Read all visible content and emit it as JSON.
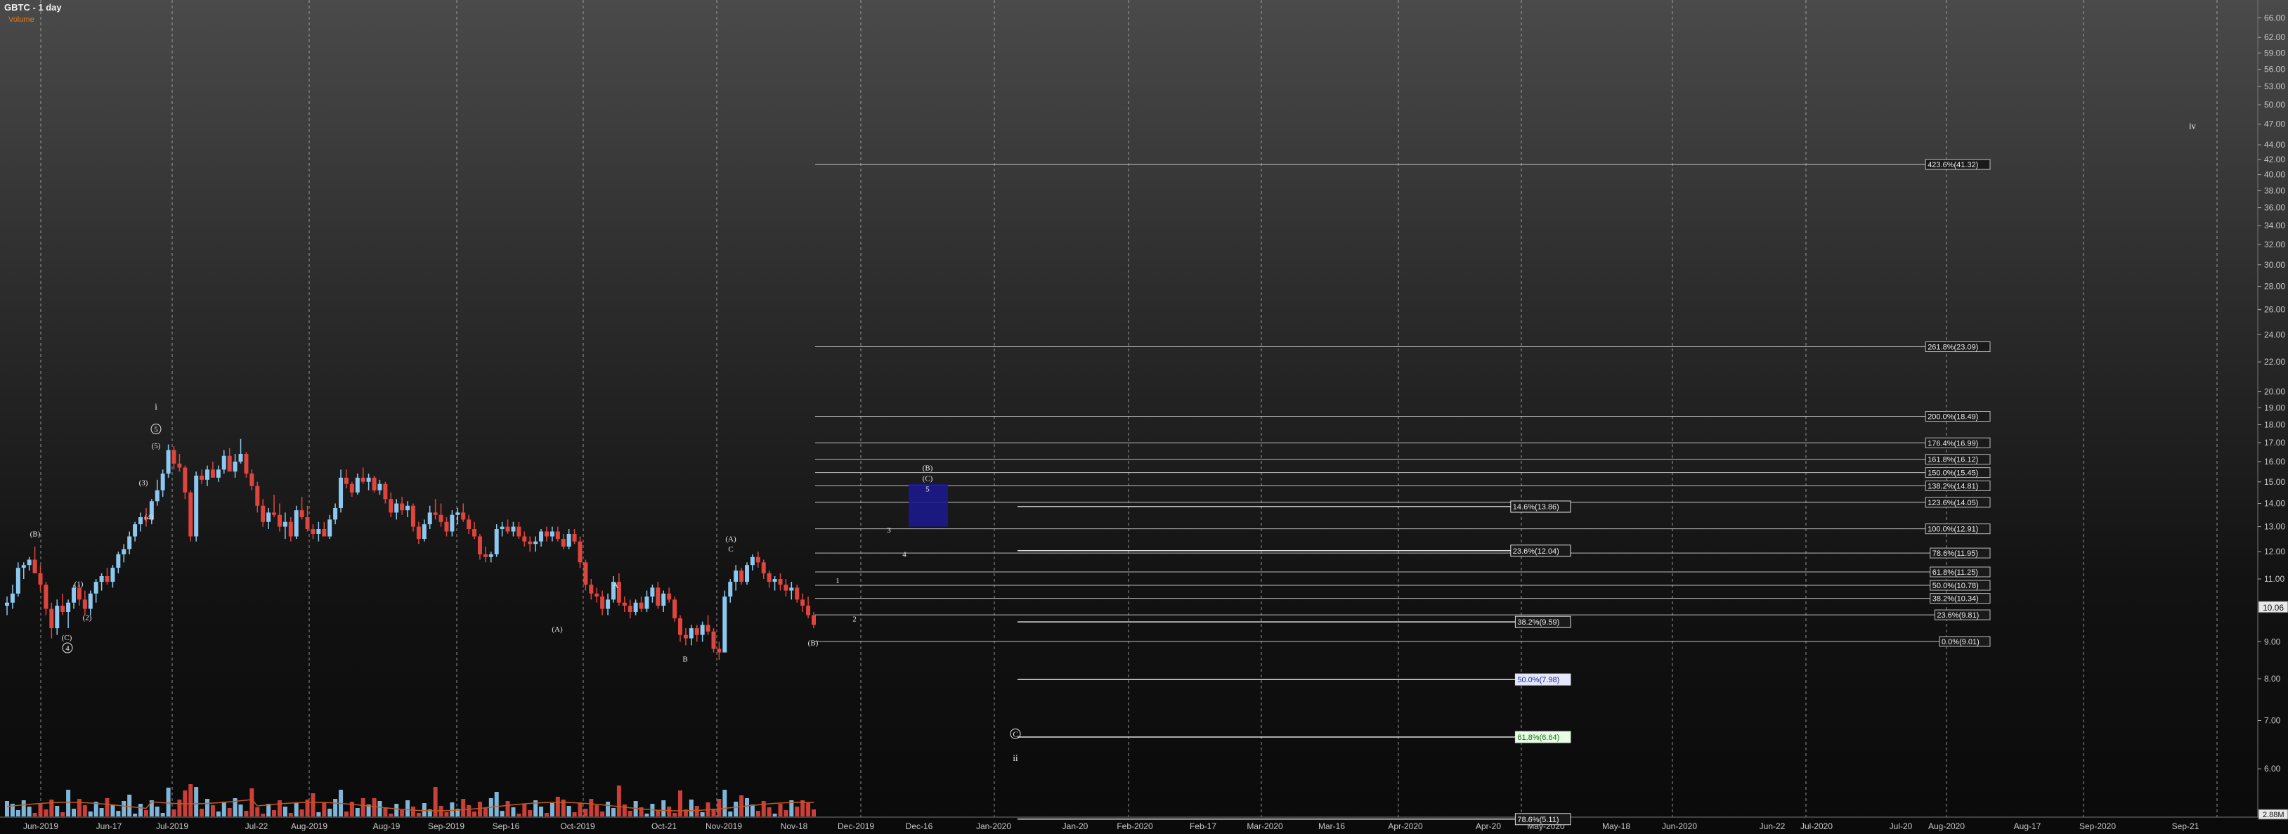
{
  "header": {
    "title": "GBTC - 1 day",
    "volume_label": "Volume"
  },
  "colors": {
    "up": "#8cc8f0",
    "down": "#e0453d",
    "grid": "#9a9a9a",
    "axis_text": "#c8c8c8",
    "box": "#1a1a8c",
    "volume_avg": "#c25a1a"
  },
  "chart_data": {
    "type": "candlestick",
    "ylim": [
      5.2,
      66.5
    ],
    "y_ticks": [
      "66.00",
      "62.00",
      "59.00",
      "56.00",
      "53.00",
      "50.00",
      "47.00",
      "44.00",
      "42.00",
      "40.00",
      "38.00",
      "36.00",
      "34.00",
      "32.00",
      "30.00",
      "28.00",
      "26.00",
      "24.00",
      "22.00",
      "20.00",
      "19.00",
      "18.00",
      "17.00",
      "16.00",
      "15.00",
      "14.00",
      "13.00",
      "12.00",
      "11.00",
      "10.00",
      "9.00",
      "8.00",
      "7.00",
      "6.00"
    ],
    "last_price": "10.06",
    "volume_readout": "2.88M",
    "x_labels": [
      "Jun-2019",
      "Jun-17",
      "Jul-2019",
      "Jul-22",
      "Aug-2019",
      "Aug-19",
      "Sep-2019",
      "Sep-16",
      "Oct-2019",
      "Oct-21",
      "Nov-2019",
      "Nov-18",
      "Dec-2019",
      "Dec-16",
      "Jan-2020",
      "Jan-20",
      "Feb-2020",
      "Feb-17",
      "Mar-2020",
      "Mar-16",
      "Apr-2020",
      "Apr-20",
      "May-2020",
      "May-18",
      "Jun-2020",
      "Jun-22",
      "Jul-2020",
      "Jul-20",
      "Aug-2020",
      "Aug-17",
      "Sep-2020",
      "Sep-21"
    ],
    "candles": [
      [
        10.1,
        10.4,
        9.8,
        10.2
      ],
      [
        10.2,
        10.8,
        10.0,
        10.5
      ],
      [
        10.5,
        11.6,
        10.4,
        11.4
      ],
      [
        11.4,
        11.6,
        11.0,
        11.5
      ],
      [
        11.5,
        11.8,
        11.3,
        11.7
      ],
      [
        11.7,
        12.2,
        11.5,
        11.2
      ],
      [
        11.2,
        11.5,
        10.6,
        10.8
      ],
      [
        10.8,
        10.9,
        9.8,
        10.0
      ],
      [
        10.0,
        10.2,
        9.1,
        9.4
      ],
      [
        9.4,
        10.3,
        9.2,
        10.1
      ],
      [
        10.1,
        10.5,
        9.8,
        9.9
      ],
      [
        9.9,
        10.3,
        9.4,
        10.2
      ],
      [
        10.2,
        10.8,
        10.0,
        10.7
      ],
      [
        10.7,
        10.8,
        10.1,
        10.3
      ],
      [
        10.3,
        10.6,
        9.8,
        10.0
      ],
      [
        10.0,
        10.6,
        9.8,
        10.5
      ],
      [
        10.5,
        11.0,
        10.2,
        10.9
      ],
      [
        10.9,
        11.2,
        10.6,
        11.1
      ],
      [
        11.1,
        11.4,
        10.8,
        10.9
      ],
      [
        10.9,
        11.5,
        10.7,
        11.4
      ],
      [
        11.4,
        12.0,
        11.2,
        11.9
      ],
      [
        11.9,
        12.3,
        11.6,
        12.1
      ],
      [
        12.1,
        12.8,
        11.9,
        12.6
      ],
      [
        12.6,
        13.2,
        12.4,
        13.1
      ],
      [
        13.1,
        13.6,
        12.8,
        13.4
      ],
      [
        13.4,
        13.8,
        13.0,
        13.3
      ],
      [
        13.3,
        14.2,
        13.1,
        14.1
      ],
      [
        14.1,
        15.1,
        13.9,
        14.6
      ],
      [
        14.6,
        15.6,
        14.3,
        15.4
      ],
      [
        15.4,
        16.9,
        15.2,
        16.6
      ],
      [
        16.6,
        16.8,
        15.6,
        15.9
      ],
      [
        15.9,
        16.4,
        15.5,
        15.7
      ],
      [
        15.7,
        15.8,
        14.2,
        14.5
      ],
      [
        14.5,
        14.6,
        12.4,
        12.6
      ],
      [
        12.6,
        15.5,
        12.4,
        15.3
      ],
      [
        15.3,
        15.6,
        14.9,
        15.1
      ],
      [
        15.1,
        15.8,
        14.8,
        15.6
      ],
      [
        15.6,
        16.0,
        15.3,
        15.2
      ],
      [
        15.2,
        15.8,
        15.0,
        15.6
      ],
      [
        15.6,
        16.6,
        15.4,
        16.3
      ],
      [
        16.3,
        16.7,
        15.9,
        15.5
      ],
      [
        15.5,
        16.4,
        15.2,
        16.0
      ],
      [
        16.0,
        17.2,
        15.9,
        16.4
      ],
      [
        16.4,
        16.5,
        15.2,
        15.4
      ],
      [
        15.4,
        15.6,
        14.6,
        14.8
      ],
      [
        14.8,
        15.0,
        13.6,
        13.9
      ],
      [
        13.9,
        14.2,
        13.0,
        13.2
      ],
      [
        13.2,
        13.8,
        12.9,
        13.6
      ],
      [
        13.6,
        14.4,
        13.4,
        13.5
      ],
      [
        13.5,
        14.0,
        12.8,
        13.0
      ],
      [
        13.0,
        13.6,
        12.5,
        13.2
      ],
      [
        13.2,
        13.4,
        12.4,
        12.6
      ],
      [
        12.6,
        13.9,
        12.5,
        13.7
      ],
      [
        13.7,
        14.3,
        13.3,
        13.4
      ],
      [
        13.4,
        13.9,
        12.8,
        12.9
      ],
      [
        12.9,
        13.1,
        12.5,
        12.7
      ],
      [
        12.7,
        13.2,
        12.4,
        12.9
      ],
      [
        12.9,
        13.2,
        12.6,
        12.6
      ],
      [
        12.6,
        13.5,
        12.5,
        13.3
      ],
      [
        13.3,
        14.0,
        13.1,
        13.8
      ],
      [
        13.8,
        15.6,
        13.6,
        15.2
      ],
      [
        15.2,
        15.6,
        14.7,
        14.9
      ],
      [
        14.9,
        15.0,
        14.3,
        14.5
      ],
      [
        14.5,
        15.4,
        14.4,
        15.2
      ],
      [
        15.2,
        15.7,
        14.9,
        15.0
      ],
      [
        15.0,
        15.4,
        14.6,
        15.2
      ],
      [
        15.2,
        15.3,
        14.5,
        14.6
      ],
      [
        14.6,
        15.1,
        14.4,
        14.9
      ],
      [
        14.9,
        15.0,
        14.0,
        14.2
      ],
      [
        14.2,
        14.5,
        13.4,
        13.6
      ],
      [
        13.6,
        14.2,
        13.3,
        14.0
      ],
      [
        14.0,
        14.3,
        13.5,
        13.7
      ],
      [
        13.7,
        14.1,
        13.4,
        13.9
      ],
      [
        13.9,
        14.0,
        12.8,
        13.0
      ],
      [
        13.0,
        13.2,
        12.3,
        12.5
      ],
      [
        12.5,
        13.3,
        12.4,
        13.1
      ],
      [
        13.1,
        13.9,
        12.9,
        13.6
      ],
      [
        13.6,
        14.2,
        13.3,
        13.5
      ],
      [
        13.5,
        14.0,
        13.0,
        13.2
      ],
      [
        13.2,
        13.4,
        12.6,
        12.8
      ],
      [
        12.8,
        13.7,
        12.6,
        13.5
      ],
      [
        13.5,
        13.8,
        13.1,
        13.6
      ],
      [
        13.6,
        14.0,
        13.2,
        13.3
      ],
      [
        13.3,
        13.5,
        12.7,
        12.9
      ],
      [
        12.9,
        13.2,
        12.5,
        12.6
      ],
      [
        12.6,
        12.7,
        11.7,
        11.9
      ],
      [
        11.9,
        12.2,
        11.6,
        11.8
      ],
      [
        11.8,
        12.0,
        11.6,
        11.9
      ],
      [
        11.9,
        13.1,
        11.8,
        12.9
      ],
      [
        12.9,
        13.2,
        12.6,
        13.0
      ],
      [
        13.0,
        13.3,
        12.7,
        12.8
      ],
      [
        12.8,
        13.2,
        12.6,
        13.0
      ],
      [
        13.0,
        13.2,
        12.5,
        12.6
      ],
      [
        12.6,
        12.8,
        12.2,
        12.4
      ],
      [
        12.4,
        12.6,
        12.0,
        12.3
      ],
      [
        12.3,
        12.6,
        12.0,
        12.4
      ],
      [
        12.4,
        12.9,
        12.2,
        12.8
      ],
      [
        12.8,
        13.0,
        12.4,
        12.6
      ],
      [
        12.6,
        13.0,
        12.4,
        12.8
      ],
      [
        12.8,
        13.0,
        12.4,
        12.5
      ],
      [
        12.5,
        12.7,
        12.1,
        12.2
      ],
      [
        12.2,
        12.9,
        12.1,
        12.7
      ],
      [
        12.7,
        12.9,
        12.3,
        12.4
      ],
      [
        12.4,
        12.6,
        11.4,
        11.6
      ],
      [
        11.6,
        11.7,
        10.6,
        10.8
      ],
      [
        10.8,
        11.0,
        10.3,
        10.5
      ],
      [
        10.5,
        10.7,
        10.2,
        10.4
      ],
      [
        10.4,
        10.6,
        9.8,
        10.0
      ],
      [
        10.0,
        10.5,
        9.8,
        10.3
      ],
      [
        10.3,
        11.1,
        10.2,
        10.9
      ],
      [
        10.9,
        11.2,
        10.1,
        10.2
      ],
      [
        10.2,
        10.4,
        9.9,
        10.1
      ],
      [
        10.1,
        10.3,
        9.7,
        9.9
      ],
      [
        9.9,
        10.3,
        9.8,
        10.2
      ],
      [
        10.2,
        10.4,
        9.9,
        10.0
      ],
      [
        10.0,
        10.6,
        9.9,
        10.4
      ],
      [
        10.4,
        10.8,
        10.2,
        10.7
      ],
      [
        10.7,
        10.9,
        10.0,
        10.1
      ],
      [
        10.1,
        10.6,
        9.9,
        10.5
      ],
      [
        10.5,
        10.7,
        10.2,
        10.3
      ],
      [
        10.3,
        10.4,
        9.6,
        9.7
      ],
      [
        9.7,
        9.8,
        9.0,
        9.2
      ],
      [
        9.2,
        9.4,
        8.9,
        9.1
      ],
      [
        9.1,
        9.5,
        8.9,
        9.4
      ],
      [
        9.4,
        9.5,
        9.0,
        9.2
      ],
      [
        9.2,
        9.6,
        9.0,
        9.5
      ],
      [
        9.5,
        9.8,
        9.2,
        9.3
      ],
      [
        9.3,
        9.4,
        8.7,
        8.8
      ],
      [
        8.8,
        9.0,
        8.5,
        8.7
      ],
      [
        8.7,
        10.6,
        8.7,
        10.4
      ],
      [
        10.4,
        11.0,
        10.2,
        10.9
      ],
      [
        10.9,
        11.5,
        10.6,
        11.3
      ],
      [
        11.3,
        11.4,
        10.8,
        10.9
      ],
      [
        10.9,
        11.6,
        10.8,
        11.5
      ],
      [
        11.5,
        11.9,
        11.3,
        11.8
      ],
      [
        11.8,
        12.0,
        11.4,
        11.6
      ],
      [
        11.6,
        11.7,
        11.0,
        11.2
      ],
      [
        11.2,
        11.3,
        10.7,
        10.9
      ],
      [
        10.9,
        11.1,
        10.6,
        11.0
      ],
      [
        11.0,
        11.2,
        10.6,
        10.8
      ],
      [
        10.8,
        11.0,
        10.4,
        10.6
      ],
      [
        10.6,
        10.9,
        10.3,
        10.7
      ],
      [
        10.7,
        10.8,
        10.2,
        10.3
      ],
      [
        10.3,
        10.5,
        9.9,
        10.1
      ],
      [
        10.1,
        10.4,
        9.7,
        9.8
      ],
      [
        9.8,
        9.9,
        9.4,
        9.5
      ]
    ],
    "volume_max_label": "",
    "annotations": {
      "wave_labels": [
        "(B)",
        "(C)",
        "4",
        "(1)",
        "(2)",
        "(3)",
        "(4)",
        "(5)",
        "5",
        "i",
        "(A)",
        "C",
        "A",
        "B",
        "(B)",
        "(A)",
        "3",
        "4",
        "1",
        "2",
        "(B)",
        "(C)",
        "5",
        "C",
        "ii",
        "iv"
      ]
    },
    "fib_levels": [
      {
        "label": "423.6%(41.32)",
        "value": 41.32
      },
      {
        "label": "261.8%(23.09)",
        "value": 23.09
      },
      {
        "label": "200.0%(18.49)",
        "value": 18.49
      },
      {
        "label": "176.4%(16.99)",
        "value": 16.99
      },
      {
        "label": "161.8%(16.12)",
        "value": 16.12
      },
      {
        "label": "150.0%(15.45)",
        "value": 15.45
      },
      {
        "label": "138.2%(14.81)",
        "value": 14.81
      },
      {
        "label": "123.6%(14.05)",
        "value": 14.05
      },
      {
        "label": "100.0%(12.91)",
        "value": 12.91
      },
      {
        "label": "78.6%(11.95)",
        "value": 11.95
      },
      {
        "label": "61.8%(11.25)",
        "value": 11.25
      },
      {
        "label": "50.0%(10.78)",
        "value": 10.78
      },
      {
        "label": "38.2%(10.34)",
        "value": 10.34
      },
      {
        "label": "23.6%(9.81)",
        "value": 9.81
      },
      {
        "label": "0.0%(9.01)",
        "value": 9.01
      }
    ],
    "fib_levels_2": [
      {
        "label": "14.6%(13.86)",
        "value": 13.86
      },
      {
        "label": "23.6%(12.04)",
        "value": 12.04
      },
      {
        "label": "38.2%(9.59)",
        "value": 9.59
      },
      {
        "label": "50.0%(7.98)",
        "value": 7.98,
        "highlight": "blue"
      },
      {
        "label": "61.8%(6.64)",
        "value": 6.64,
        "highlight": "green"
      },
      {
        "label": "78.6%(5.11)",
        "value": 5.11
      }
    ]
  }
}
